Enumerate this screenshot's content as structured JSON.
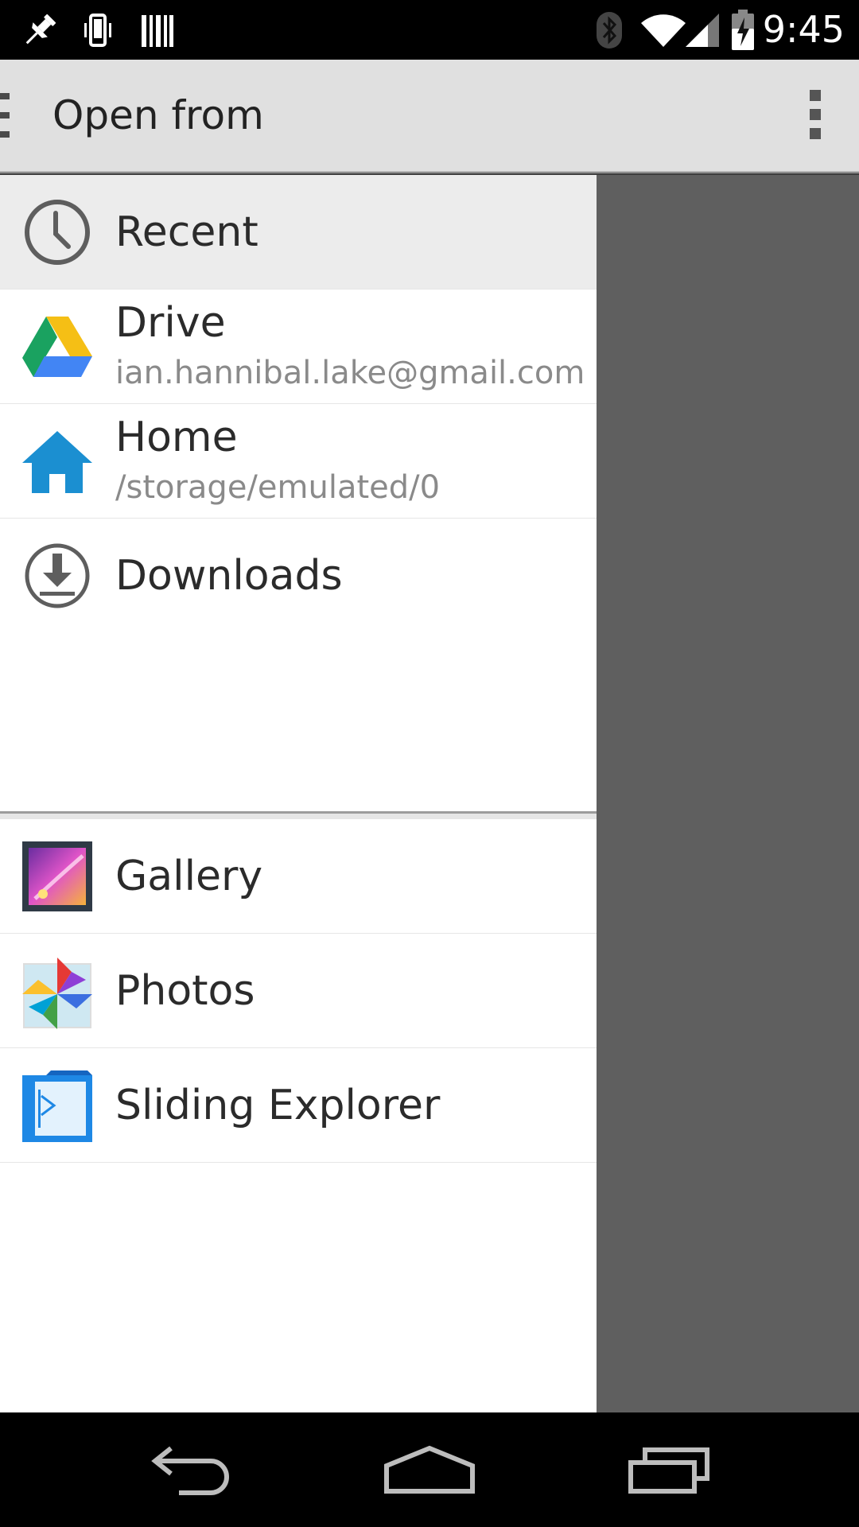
{
  "status_bar": {
    "time": "9:45",
    "icons": [
      "pin-icon",
      "phone-vibrate-icon",
      "barcode-icon",
      "bluetooth-icon",
      "wifi-icon",
      "signal-icon",
      "battery-charging-icon"
    ]
  },
  "action_bar": {
    "title": "Open from",
    "overflow_icon": "overflow-menu-icon"
  },
  "drawer": {
    "items": [
      {
        "title": "Recent",
        "icon": "clock-icon",
        "selected": true
      },
      {
        "title": "Drive",
        "subtitle": "ian.hannibal.lake@gmail.com",
        "icon": "drive-icon"
      },
      {
        "title": "Home",
        "subtitle": "/storage/emulated/0",
        "icon": "home-icon"
      },
      {
        "title": "Downloads",
        "icon": "download-icon"
      },
      {
        "title": "Gallery",
        "icon": "gallery-icon"
      },
      {
        "title": "Photos",
        "icon": "photos-icon"
      },
      {
        "title": "Sliding Explorer",
        "icon": "sliding-explorer-icon"
      }
    ]
  },
  "nav_bar": {
    "buttons": [
      "back-icon",
      "home-nav-icon",
      "recents-icon"
    ]
  },
  "colors": {
    "action_bar_bg": "#e0e0e0",
    "drawer_bg": "#ffffff",
    "selected_bg": "#ececec",
    "scrim": "#5f5f5f",
    "home_icon_blue": "#1b8fd1"
  }
}
